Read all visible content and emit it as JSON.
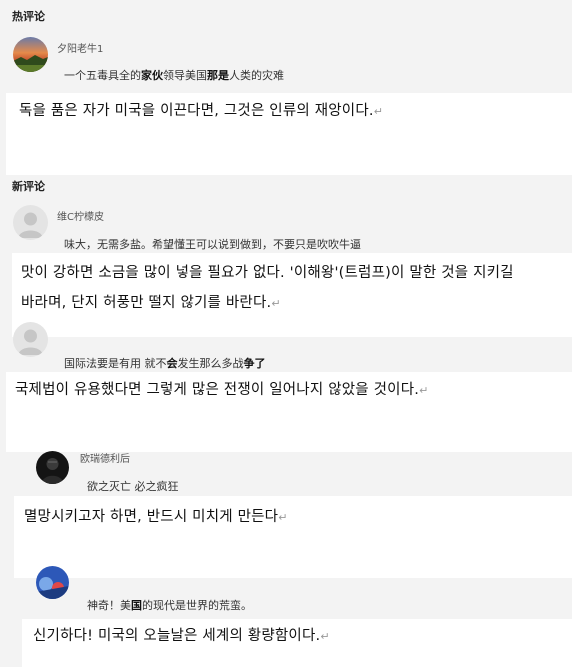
{
  "hot_section": {
    "title": "热评论",
    "comment": {
      "username": "夕阳老牛1",
      "text_pre": "一个五毒具全的",
      "text_hl": "家伙",
      "text_mid": "领导美国",
      "text_hl2": "那是",
      "text_post": "人类的灾难"
    },
    "translation": "독을 품은 자가 미국을 이끈다면, 그것은 인류의 재앙이다."
  },
  "new_section": {
    "title": "新评论",
    "comments": [
      {
        "username": "维C柠檬皮",
        "text": "味大，无需多盐。希望懂王可以说到做到，不要只是吹吹牛逼",
        "translation_lines": [
          "맛이 강하면 소금을 많이 넣을 필요가 없다. '이해왕'(트럼프)이 말한 것을 지키길",
          "바라며, 단지 허풍만 떨지 않기를 바란다."
        ]
      },
      {
        "username": "",
        "text_pre": "国际法要是有用 就不",
        "text_hl": "会",
        "text_mid": "发生那么多战",
        "text_hl2": "争了",
        "text_post": "",
        "translation": "국제법이 유용했다면 그렇게 많은 전쟁이 일어나지 않았을 것이다."
      },
      {
        "username": "欧瑞德利后",
        "text": "欲之灭亡 必之疯狂",
        "translation": "멸망시키고자 하면, 반드시 미치게 만든다"
      },
      {
        "username": "",
        "text_pre": "神奇！美",
        "text_hl": "国",
        "text_post": "的现代是世界的荒蛮。",
        "translation": "신기하다! 미국의 오늘날은 세계의 황량함이다."
      }
    ]
  },
  "return_mark": "↵",
  "icons": {
    "avatar_sunset": "sunset-landscape-avatar",
    "avatar_default": "default-user-avatar",
    "avatar_dark": "dark-figure-avatar",
    "avatar_blue": "blue-graphic-avatar"
  },
  "colors": {
    "page_bg": "#f3f3f3",
    "overlay_bg": "#ffffff",
    "text": "#333333",
    "meta": "#555555"
  }
}
